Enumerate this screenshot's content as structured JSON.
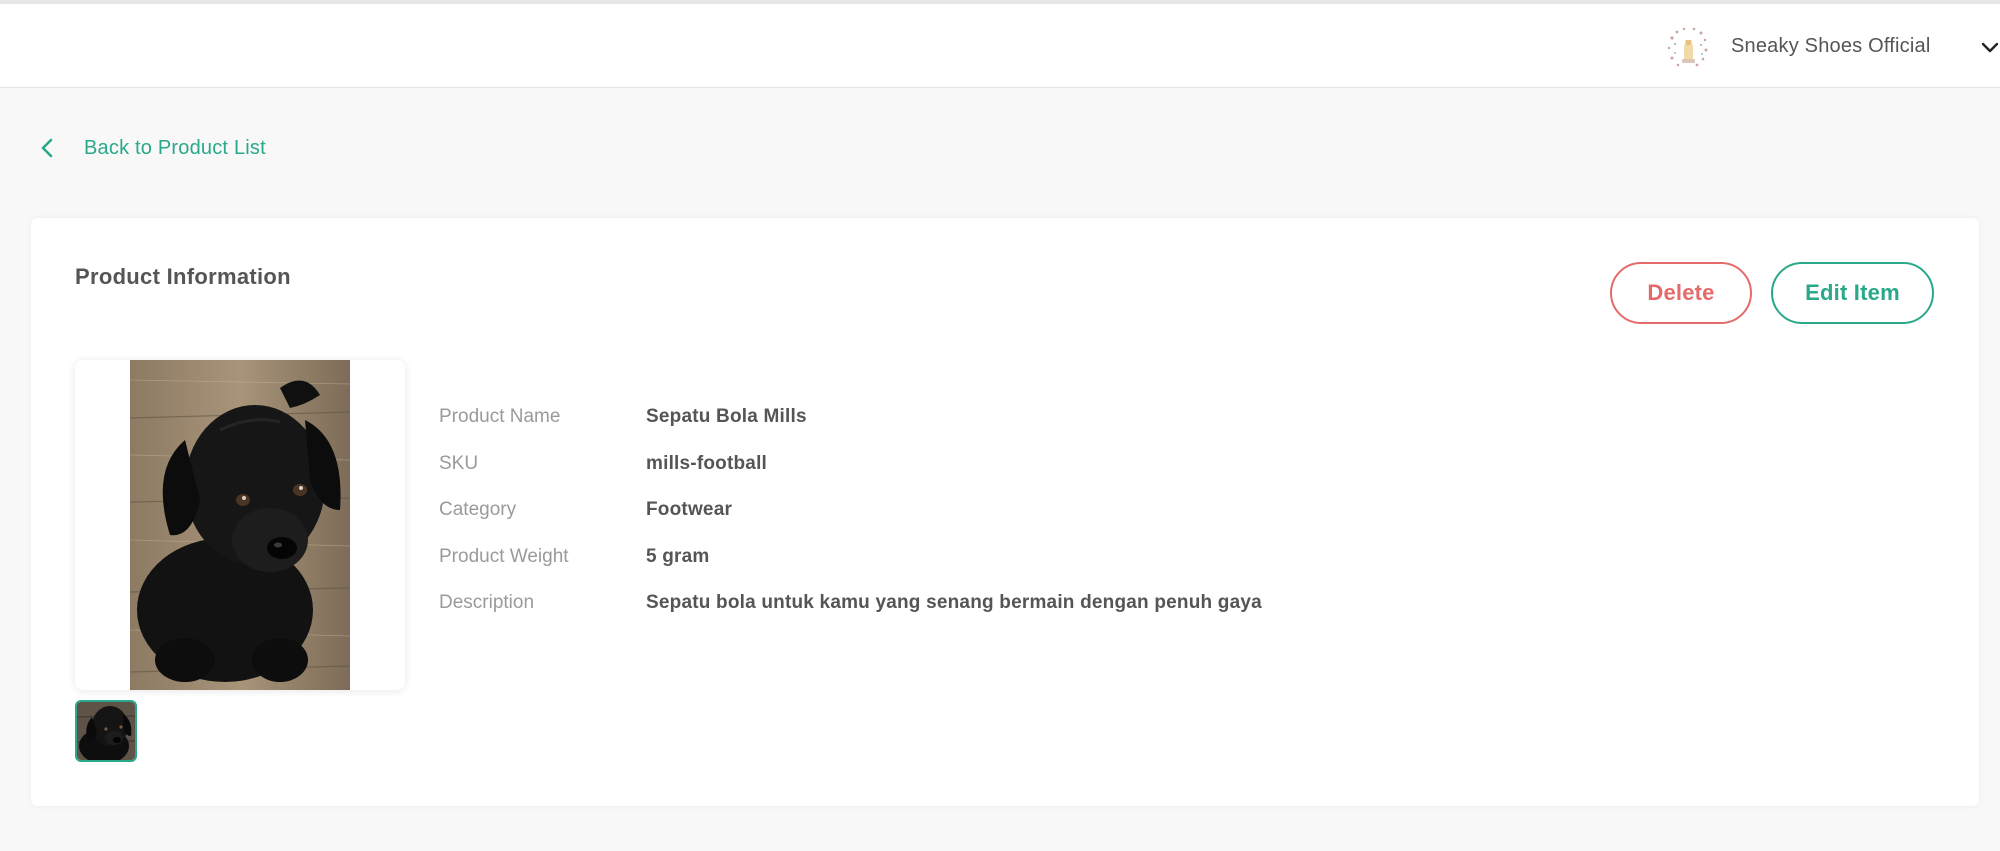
{
  "header": {
    "shop_name": "Sneaky Shoes Official",
    "shop_avatar_icon": "shop-logo-avatar",
    "dropdown_icon": "chevron-down-icon"
  },
  "nav": {
    "back_label": "Back to Product List",
    "back_icon": "chevron-left-icon"
  },
  "card": {
    "title": "Product Information",
    "delete_label": "Delete",
    "edit_label": "Edit Item",
    "image_icon": "product-photo-black-puppy"
  },
  "product": {
    "fields": [
      {
        "label": "Product Name",
        "value": "Sepatu Bola Mills"
      },
      {
        "label": "SKU",
        "value": "mills-football"
      },
      {
        "label": "Category",
        "value": "Footwear"
      },
      {
        "label": "Product Weight",
        "value": "5 gram"
      },
      {
        "label": "Description",
        "value": "Sepatu bola untuk kamu yang senang bermain dengan penuh gaya"
      }
    ]
  },
  "colors": {
    "accent": "#2aa88a",
    "danger": "#e56b6b",
    "text": "#555555",
    "muted": "#9a9a9a",
    "page_bg": "#f8f8f8"
  }
}
